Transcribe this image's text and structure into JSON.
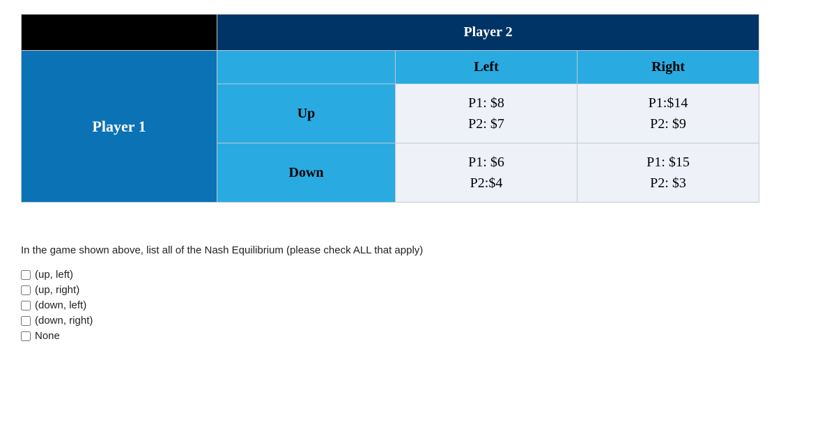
{
  "table": {
    "player2_header": "Player 2",
    "player1_header": "Player 1",
    "col_left": "Left",
    "col_right": "Right",
    "row_up": "Up",
    "row_down": "Down",
    "payoffs": {
      "up_left": {
        "p1": "P1: $8",
        "p2": "P2: $7"
      },
      "up_right": {
        "p1": "P1:$14",
        "p2": "P2: $9"
      },
      "down_left": {
        "p1": "P1: $6",
        "p2": "P2:$4"
      },
      "down_right": {
        "p1": "P1: $15",
        "p2": "P2: $3"
      }
    }
  },
  "question": "In the game shown above, list all of the Nash Equilibrium (please check ALL that apply)",
  "options": [
    "(up, left)",
    "(up, right)",
    "(down, left)",
    "(down, right)",
    "None"
  ]
}
